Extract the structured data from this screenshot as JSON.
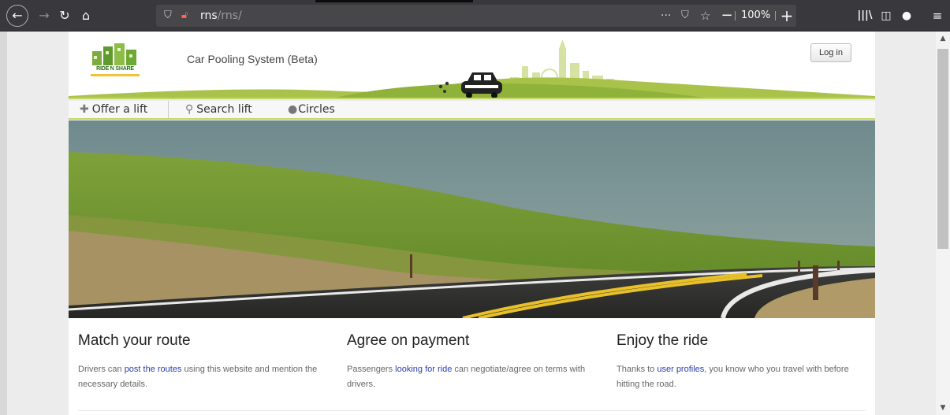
{
  "browser": {
    "url_host": "rns",
    "url_path": "/rns/",
    "zoom": "100%",
    "page_actions_icon": "···",
    "icons": [
      "back-icon",
      "forward-icon",
      "reload-icon",
      "home-icon",
      "shield-icon",
      "insecure-lock-icon",
      "pocket-icon",
      "bookmark-star-icon",
      "zoom-out-icon",
      "zoom-in-icon",
      "library-icon",
      "sidebar-icon",
      "account-icon",
      "menu-icon"
    ]
  },
  "header": {
    "logo_text": "RIDE N SHARE",
    "title": "Car Pooling System (Beta)",
    "login_label": "Log in"
  },
  "nav": {
    "items": [
      {
        "icon": "plus-icon",
        "label": "Offer a lift"
      },
      {
        "icon": "search-icon",
        "label": "Search lift"
      },
      {
        "icon": "globe-icon",
        "label": "Circles"
      }
    ]
  },
  "features": [
    {
      "title": "Match your route",
      "text_before": "Drivers can ",
      "link": "post the routes",
      "text_after": " using this website and mention the necessary details."
    },
    {
      "title": "Agree on payment",
      "text_before": "Passengers ",
      "link": "looking for ride",
      "text_after": " can negotiate/agree on terms with drivers."
    },
    {
      "title": "Enjoy the ride",
      "text_before": "Thanks to ",
      "link": "user profiles",
      "text_after": ", you know who you travel with before hitting the road."
    }
  ],
  "colors": {
    "accent_green": "#c5d76b",
    "link_blue": "#2a3fb0",
    "chrome_dark": "#38383d"
  }
}
